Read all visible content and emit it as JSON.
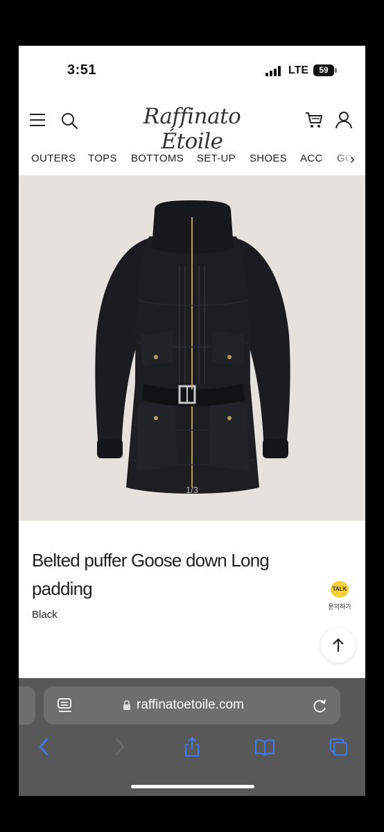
{
  "status": {
    "time": "3:51",
    "network": "LTE",
    "battery": "59"
  },
  "header": {
    "logo": "Raffinato Étoile"
  },
  "nav": {
    "items": [
      "OUTERS",
      "TOPS",
      "BOTTOMS",
      "SET-UP",
      "SHOES",
      "ACC",
      "GO"
    ]
  },
  "gallery": {
    "indicator": "1/3"
  },
  "product": {
    "title": "Belted puffer Goose down Long padding",
    "color": "Black"
  },
  "chat": {
    "badge": "TALK",
    "label": "문의하기"
  },
  "browser": {
    "url": "raffinatoetoile.com"
  },
  "colors": {
    "accent_icon": "#3d7bf2",
    "talk_yellow": "#f4d23b",
    "background_image": "#e5e1dd"
  }
}
